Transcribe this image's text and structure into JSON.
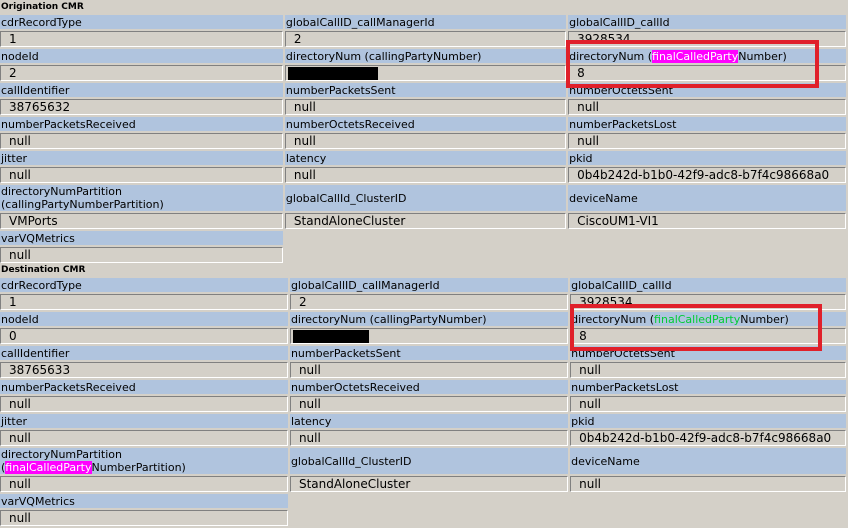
{
  "origination": {
    "title": "Origination CMR",
    "rows": [
      {
        "l1": "cdrRecordType",
        "v1": "1",
        "l2": "globalCallID_callManagerId",
        "v2": "2",
        "l3": "globalCallID_callId",
        "v3": "3928534"
      },
      {
        "l1": "nodeId",
        "v1": "2",
        "l2": "directoryNum (callingPartyNumber)",
        "v2": "",
        "l3_pre": "directoryNum (",
        "l3_hl": "finalCalledParty",
        "l3_post": "Number)",
        "v3": "8"
      },
      {
        "l1": "callIdentifier",
        "v1": "38765632",
        "l2": "numberPacketsSent",
        "v2": "null",
        "l3": "numberOctetsSent",
        "v3": "null"
      },
      {
        "l1": "numberPacketsReceived",
        "v1": "null",
        "l2": "numberOctetsReceived",
        "v2": "null",
        "l3": "numberPacketsLost",
        "v3": "null"
      },
      {
        "l1": "jitter",
        "v1": "null",
        "l2": "latency",
        "v2": "null",
        "l3": "pkid",
        "v3": "0b4b242d-b1b0-42f9-adc8-b7f4c98668a0"
      },
      {
        "l1_a": "directoryNumPartition",
        "l1_b": "(callingPartyNumberPartition)",
        "v1": "VMPorts",
        "l2": "globalCallId_ClusterID",
        "v2": "StandAloneCluster",
        "l3": "deviceName",
        "v3": "CiscoUM1-VI1"
      },
      {
        "l1": "varVQMetrics",
        "v1": "null"
      }
    ]
  },
  "destination": {
    "title": "Destination CMR",
    "rows": [
      {
        "l1": "cdrRecordType",
        "v1": "1",
        "l2": "globalCallID_callManagerId",
        "v2": "2",
        "l3": "globalCallID_callId",
        "v3": "3928534"
      },
      {
        "l1": "nodeId",
        "v1": "0",
        "l2": "directoryNum (callingPartyNumber)",
        "v2": "",
        "l3_pre": "directoryNum (",
        "l3_hl": "finalCalledParty",
        "l3_post": "Number)",
        "v3": "8"
      },
      {
        "l1": "callIdentifier",
        "v1": "38765633",
        "l2": "numberPacketsSent",
        "v2": "null",
        "l3": "numberOctetsSent",
        "v3": "null"
      },
      {
        "l1": "numberPacketsReceived",
        "v1": "null",
        "l2": "numberOctetsReceived",
        "v2": "null",
        "l3": "numberPacketsLost",
        "v3": "null"
      },
      {
        "l1": "jitter",
        "v1": "null",
        "l2": "latency",
        "v2": "null",
        "l3": "pkid",
        "v3": "0b4b242d-b1b0-42f9-adc8-b7f4c98668a0"
      },
      {
        "l1_a": "directoryNumPartition",
        "l1_b_pre": "(",
        "l1_b_hl": "finalCalledParty",
        "l1_b_post": "NumberPartition)",
        "v1": "null",
        "l2": "globalCallId_ClusterID",
        "v2": "StandAloneCluster",
        "l3": "deviceName",
        "v3": "null"
      },
      {
        "l1": "varVQMetrics",
        "v1": "null"
      }
    ]
  },
  "colors": {
    "label_bg": "#b0c4de",
    "page_bg": "#d4d0c8",
    "highlight_magenta": "#ff00ff",
    "highlight_green": "#00cc33",
    "annotation_red": "#e0202a",
    "redaction": "#000000"
  }
}
